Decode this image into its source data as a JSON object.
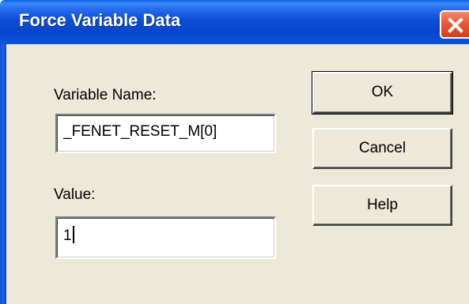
{
  "window": {
    "title": "Force Variable Data"
  },
  "form": {
    "variable_name_label": "Variable Name:",
    "variable_name_value": "_FENET_RESET_M[0]",
    "value_label": "Value:",
    "value_value": "1"
  },
  "buttons": {
    "ok_label": "OK",
    "cancel_label": "Cancel",
    "help_label": "Help"
  },
  "colors": {
    "titlebar": "#0846cc",
    "close_button": "#e45a38",
    "dialog_face": "#ece9d8"
  },
  "icons": {
    "close": "close-icon"
  }
}
